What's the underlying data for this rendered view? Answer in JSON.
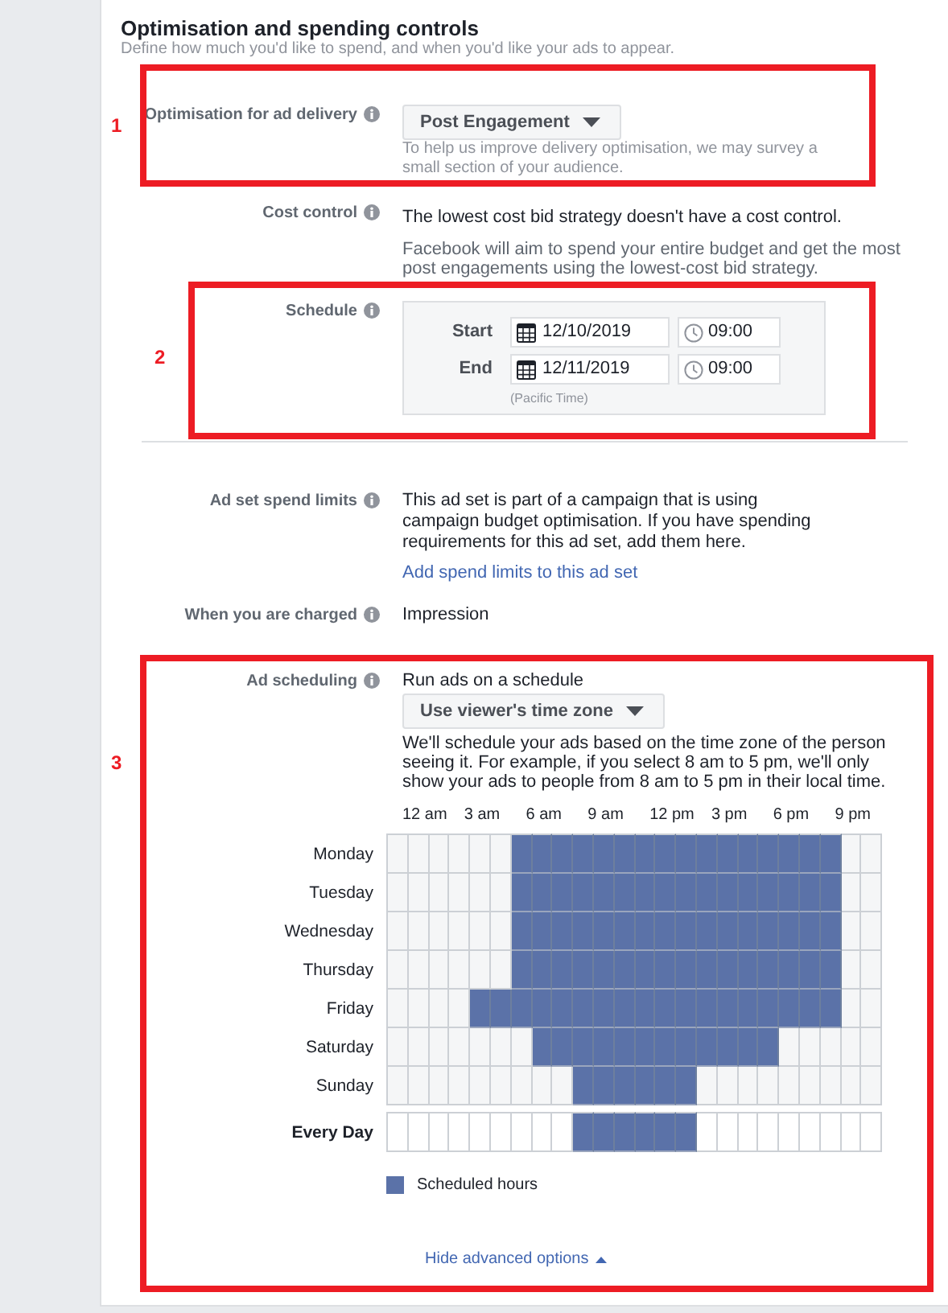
{
  "section": {
    "title": "Optimisation and spending controls",
    "subtitle": "Define how much you'd like to spend, and when you'd like your ads to appear."
  },
  "optimisation": {
    "label": "Optimisation for ad delivery",
    "dropdown": "Post Engagement",
    "help": "To help us improve delivery optimisation, we may survey a small section of your audience."
  },
  "cost_control": {
    "label": "Cost control",
    "text": "The lowest cost bid strategy doesn't have a cost control.",
    "detail": "Facebook will aim to spend your entire budget and get the most post engagements using the lowest-cost bid strategy."
  },
  "schedule": {
    "label": "Schedule",
    "start": {
      "label": "Start",
      "date": "12/10/2019",
      "time": "09:00"
    },
    "end": {
      "label": "End",
      "date": "12/11/2019",
      "time": "09:00"
    },
    "timezone": "(Pacific Time)"
  },
  "spend_limits": {
    "label": "Ad set spend limits",
    "text": "This ad set is part of a campaign that is using campaign budget optimisation. If you have spending requirements for this ad set, add them here.",
    "link": "Add spend limits to this ad set"
  },
  "charged": {
    "label": "When you are charged",
    "value": "Impression"
  },
  "ad_scheduling": {
    "label": "Ad scheduling",
    "title": "Run ads on a schedule",
    "dropdown": "Use viewer's time zone",
    "help": "We'll schedule your ads based on the time zone of the person seeing it. For example, if you select 8 am to 5 pm, we'll only show your ads to people from 8 am to 5 pm in their local time.",
    "hour_labels": [
      "12 am",
      "3 am",
      "6 am",
      "9 am",
      "12 pm",
      "3 pm",
      "6 pm",
      "9 pm"
    ],
    "days": [
      {
        "name": "Monday",
        "kind": "day",
        "slots": [
          false,
          false,
          false,
          false,
          false,
          false,
          true,
          true,
          true,
          true,
          true,
          true,
          true,
          true,
          true,
          true,
          true,
          true,
          true,
          true,
          true,
          true,
          false,
          false
        ]
      },
      {
        "name": "Tuesday",
        "kind": "day",
        "slots": [
          false,
          false,
          false,
          false,
          false,
          false,
          true,
          true,
          true,
          true,
          true,
          true,
          true,
          true,
          true,
          true,
          true,
          true,
          true,
          true,
          true,
          true,
          false,
          false
        ]
      },
      {
        "name": "Wednesday",
        "kind": "day",
        "slots": [
          false,
          false,
          false,
          false,
          false,
          false,
          true,
          true,
          true,
          true,
          true,
          true,
          true,
          true,
          true,
          true,
          true,
          true,
          true,
          true,
          true,
          true,
          false,
          false
        ]
      },
      {
        "name": "Thursday",
        "kind": "day",
        "slots": [
          false,
          false,
          false,
          false,
          false,
          false,
          true,
          true,
          true,
          true,
          true,
          true,
          true,
          true,
          true,
          true,
          true,
          true,
          true,
          true,
          true,
          true,
          false,
          false
        ]
      },
      {
        "name": "Friday",
        "kind": "day",
        "slots": [
          false,
          false,
          false,
          false,
          true,
          true,
          true,
          true,
          true,
          true,
          true,
          true,
          true,
          true,
          true,
          true,
          true,
          true,
          true,
          true,
          true,
          true,
          false,
          false
        ]
      },
      {
        "name": "Saturday",
        "kind": "day",
        "slots": [
          false,
          false,
          false,
          false,
          false,
          false,
          false,
          true,
          true,
          true,
          true,
          true,
          true,
          true,
          true,
          true,
          true,
          true,
          true,
          false,
          false,
          false,
          false,
          false
        ]
      },
      {
        "name": "Sunday",
        "kind": "day",
        "slots": [
          false,
          false,
          false,
          false,
          false,
          false,
          false,
          false,
          false,
          true,
          true,
          true,
          true,
          true,
          true,
          false,
          false,
          false,
          false,
          false,
          false,
          false,
          false,
          false
        ]
      },
      {
        "name": "Every Day",
        "kind": "summary",
        "slots": [
          false,
          false,
          false,
          false,
          false,
          false,
          false,
          false,
          false,
          true,
          true,
          true,
          true,
          true,
          true,
          false,
          false,
          false,
          false,
          false,
          false,
          false,
          false,
          false
        ]
      }
    ],
    "legend": "Scheduled hours",
    "toggle": "Hide advanced options"
  },
  "annotations": [
    {
      "label": "1"
    },
    {
      "label": "2"
    },
    {
      "label": "3"
    }
  ]
}
